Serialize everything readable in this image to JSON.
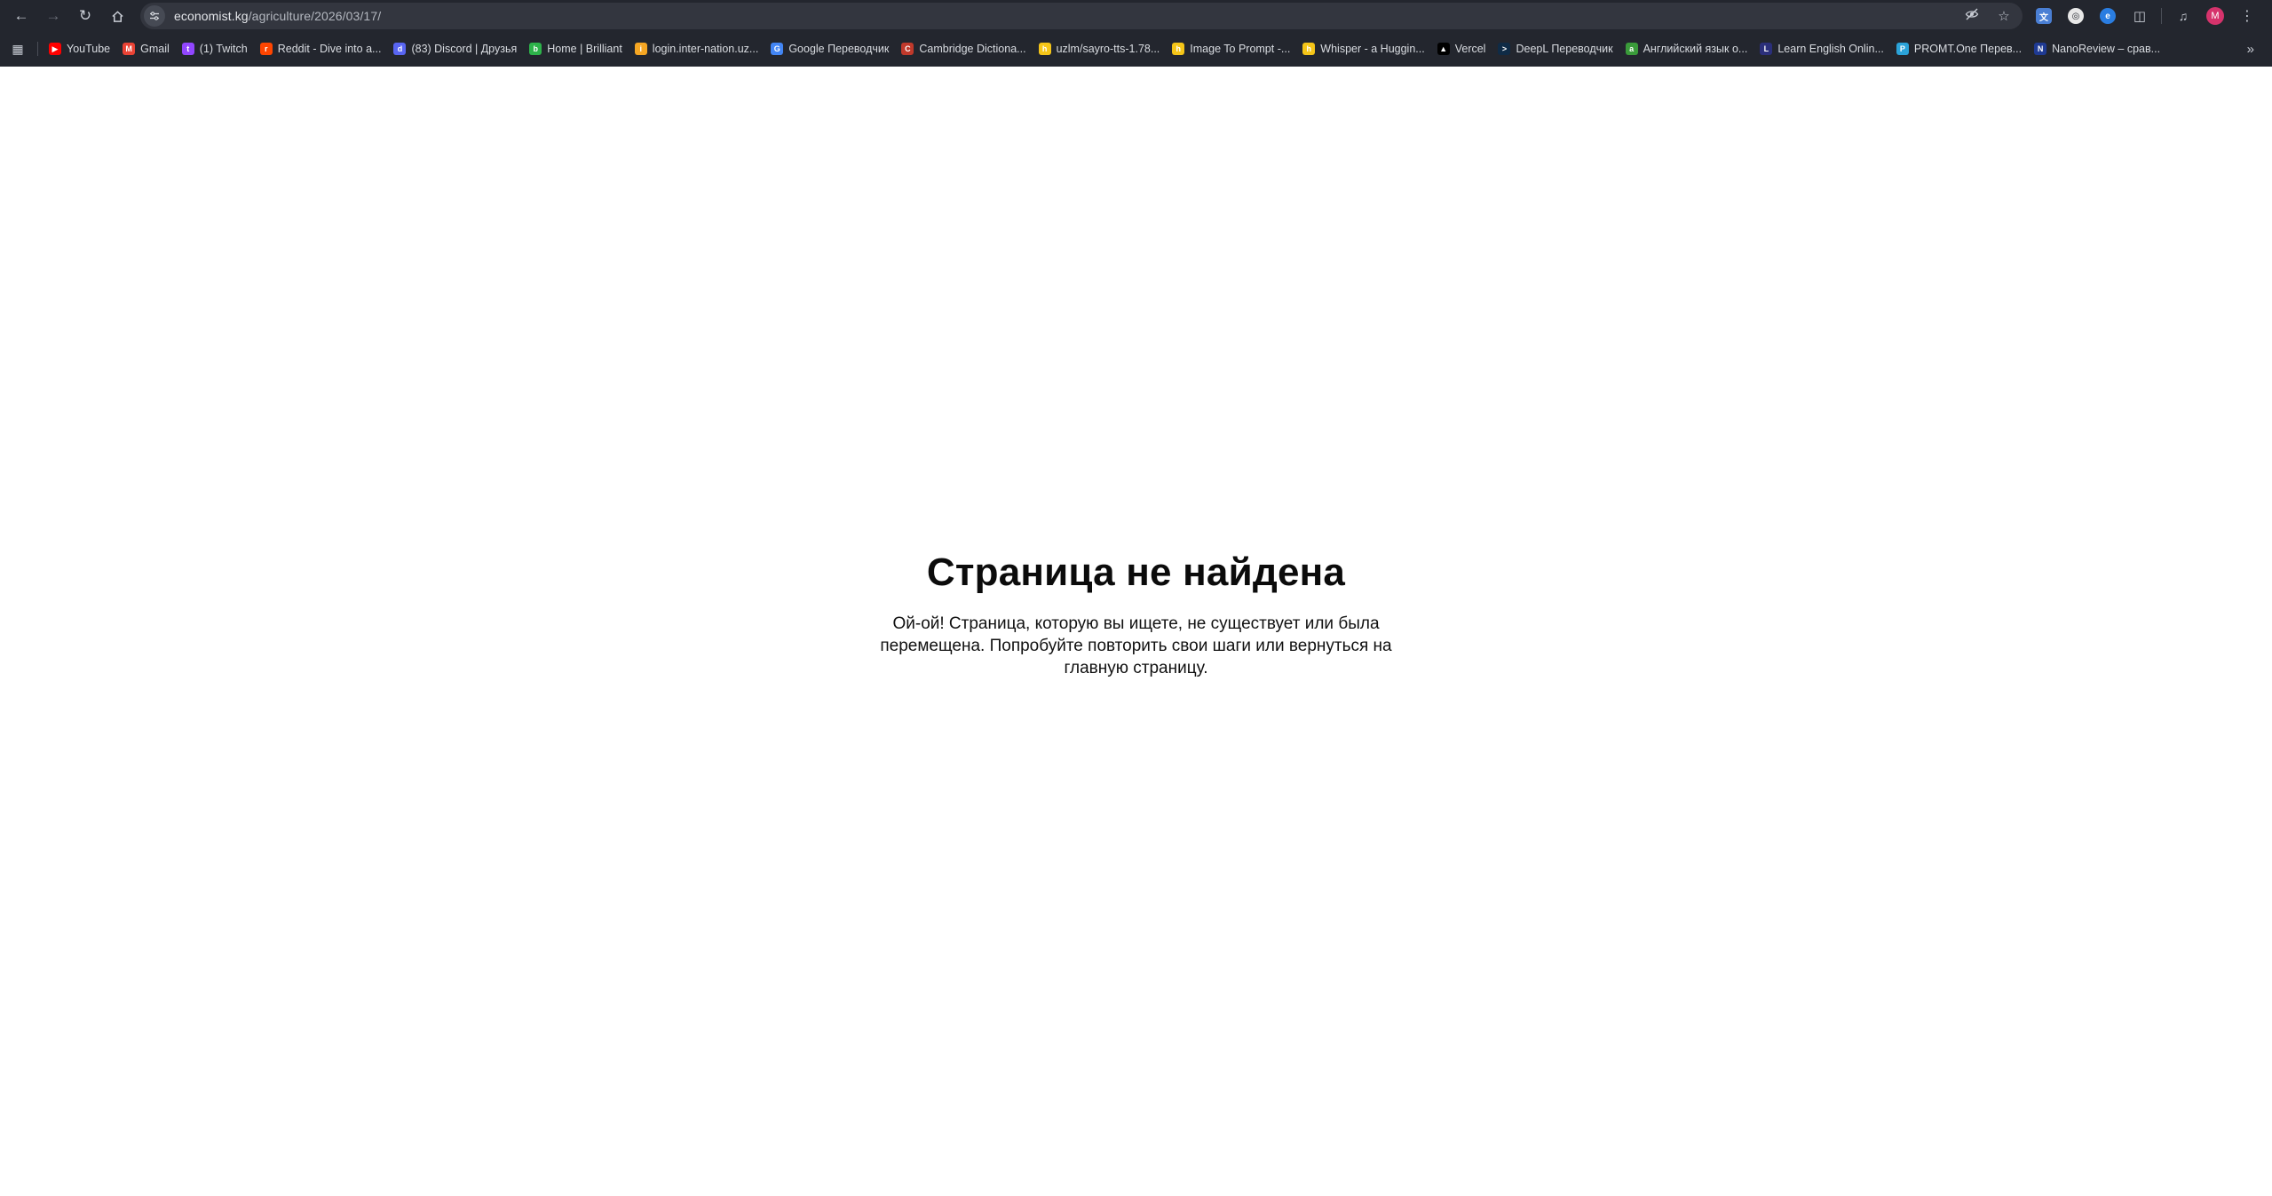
{
  "browser": {
    "url_host": "economist.kg",
    "url_path": "/agriculture/2026/03/17/",
    "avatar_letter": "M",
    "bookmarks": [
      {
        "label": "YouTube",
        "color": "#ff0000",
        "glyph": "▶"
      },
      {
        "label": "Gmail",
        "color": "#ea4335",
        "glyph": "M"
      },
      {
        "label": "(1) Twitch",
        "color": "#9146ff",
        "glyph": "t"
      },
      {
        "label": "Reddit - Dive into a...",
        "color": "#ff4500",
        "glyph": "r"
      },
      {
        "label": "(83) Discord | Друзья",
        "color": "#5865f2",
        "glyph": "d"
      },
      {
        "label": "Home | Brilliant",
        "color": "#2db34a",
        "glyph": "b"
      },
      {
        "label": "login.inter-nation.uz...",
        "color": "#f5a623",
        "glyph": "i"
      },
      {
        "label": "Google Переводчик",
        "color": "#4285f4",
        "glyph": "G"
      },
      {
        "label": "Cambridge Dictiona...",
        "color": "#c0392b",
        "glyph": "C"
      },
      {
        "label": "uzlm/sayro-tts-1.78...",
        "color": "#f5c518",
        "glyph": "h"
      },
      {
        "label": "Image To Prompt -...",
        "color": "#f5c518",
        "glyph": "h"
      },
      {
        "label": "Whisper - a Huggin...",
        "color": "#f5c518",
        "glyph": "h"
      },
      {
        "label": "Vercel",
        "color": "#000000",
        "glyph": "▲"
      },
      {
        "label": "DeepL Переводчик",
        "color": "#0f2b46",
        "glyph": ">"
      },
      {
        "label": "Английский язык о...",
        "color": "#3a9b3a",
        "glyph": "a"
      },
      {
        "label": "Learn English Onlin...",
        "color": "#2b2f7a",
        "glyph": "L"
      },
      {
        "label": "PROMT.One Перев...",
        "color": "#2ba3d9",
        "glyph": "P"
      },
      {
        "label": "NanoReview – срав...",
        "color": "#1f3a93",
        "glyph": "N"
      }
    ]
  },
  "page": {
    "title": "Страница не найдена",
    "message": "Ой-ой! Страница, которую вы ищете, не существует или была перемещена. Попробуйте повторить свои шаги или вернуться на главную страницу."
  }
}
